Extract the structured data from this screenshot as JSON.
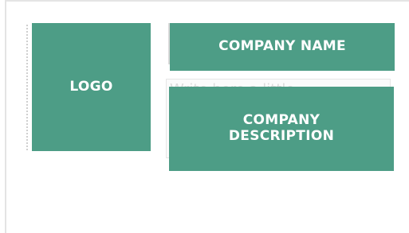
{
  "logo_block": {
    "label": "LOGO"
  },
  "company_name_block": {
    "label": "COMPANY NAME"
  },
  "company_description_block": {
    "line1": "COMPANY",
    "line2": "DESCRIPTION",
    "ghost_text": "Write here a little"
  },
  "colors": {
    "block_fill": "#4d9d86",
    "block_text": "#ffffff",
    "frame_border": "#e4e4e4"
  }
}
